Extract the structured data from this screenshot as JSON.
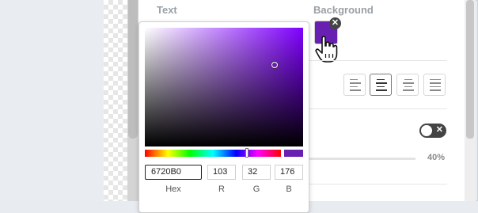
{
  "colors": {
    "background_swatch": "#6720B0",
    "accent": "#6720B0"
  },
  "labels": {
    "text_heading": "Text",
    "background_heading": "Background"
  },
  "icons": {
    "remove": "close-icon",
    "cursor": "hand-pointer-icon"
  },
  "alignment": {
    "options": [
      "align-left",
      "align-center",
      "align-right",
      "justify"
    ],
    "selected": "align-center"
  },
  "toggle": {
    "state": "off"
  },
  "opacity": {
    "value_text": "40%"
  },
  "color_picker": {
    "hex_value": "6720B0",
    "r_value": "103",
    "g_value": "32",
    "b_value": "176",
    "labels": {
      "hex": "Hex",
      "r": "R",
      "g": "G",
      "b": "B"
    },
    "hue_fraction": 0.75,
    "saturation_fraction": 0.82,
    "value_fraction": 0.69
  }
}
